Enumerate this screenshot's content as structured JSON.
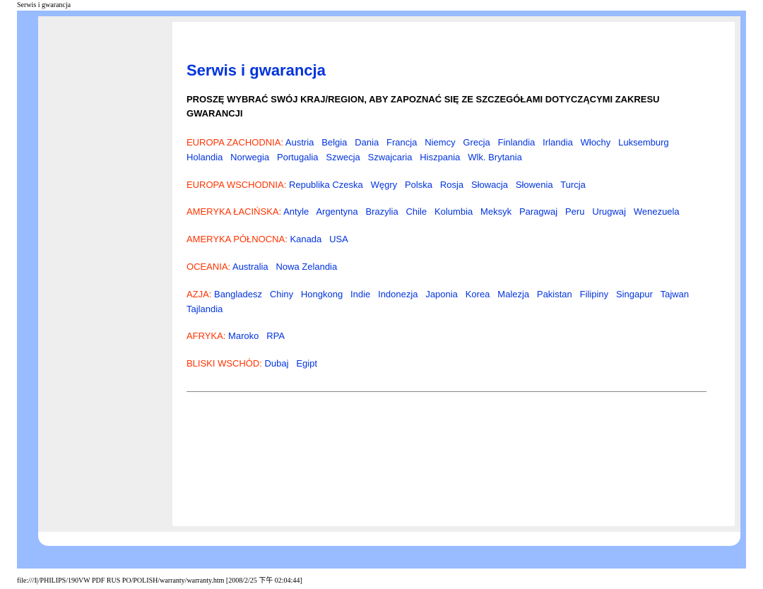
{
  "header_path": "Serwis i gwarancja",
  "title": "Serwis i gwarancja",
  "intro": "PROSZĘ WYBRAĆ SWÓJ KRAJ/REGION, ABY ZAPOZNAĆ SIĘ ZE SZCZEGÓŁAMI DOTYCZĄCYMI ZAKRESU GWARANCJI",
  "regions": [
    {
      "label": "EUROPA ZACHODNIA:",
      "countries": [
        "Austria",
        "Belgia",
        "Dania",
        "Francja",
        "Niemcy",
        "Grecja",
        "Finlandia",
        "Irlandia",
        "Włochy",
        "Luksemburg",
        "Holandia",
        "Norwegia",
        "Portugalia",
        "Szwecja",
        "Szwajcaria",
        "Hiszpania",
        "Wlk. Brytania"
      ]
    },
    {
      "label": "EUROPA WSCHODNIA:",
      "countries": [
        "Republika Czeska",
        "Węgry",
        "Polska",
        "Rosja",
        "Słowacja",
        "Słowenia",
        "Turcja"
      ]
    },
    {
      "label": "AMERYKA ŁACIŃSKA:",
      "countries": [
        "Antyle",
        "Argentyna",
        "Brazylia",
        "Chile",
        "Kolumbia",
        "Meksyk",
        "Paragwaj",
        "Peru",
        "Urugwaj",
        "Wenezuela"
      ]
    },
    {
      "label": "AMERYKA PÓŁNOCNA:",
      "countries": [
        "Kanada",
        "USA"
      ]
    },
    {
      "label": "OCEANIA:",
      "countries": [
        "Australia",
        "Nowa Zelandia"
      ]
    },
    {
      "label": "AZJA:",
      "countries": [
        "Bangladesz",
        "Chiny",
        "Hongkong",
        "Indie",
        "Indonezja",
        "Japonia",
        "Korea",
        "Malezja",
        "Pakistan",
        "Filipiny",
        "Singapur",
        "Tajwan",
        "Tajlandia"
      ]
    },
    {
      "label": "AFRYKA:",
      "countries": [
        "Maroko",
        "RPA"
      ]
    },
    {
      "label": "BLISKI WSCHÓD:",
      "countries": [
        "Dubaj",
        "Egipt"
      ]
    }
  ],
  "footer_path": "file:///I|/PHILIPS/190VW PDF RUS PO/POLISH/warranty/warranty.htm [2008/2/25 下午 02:04:44]"
}
